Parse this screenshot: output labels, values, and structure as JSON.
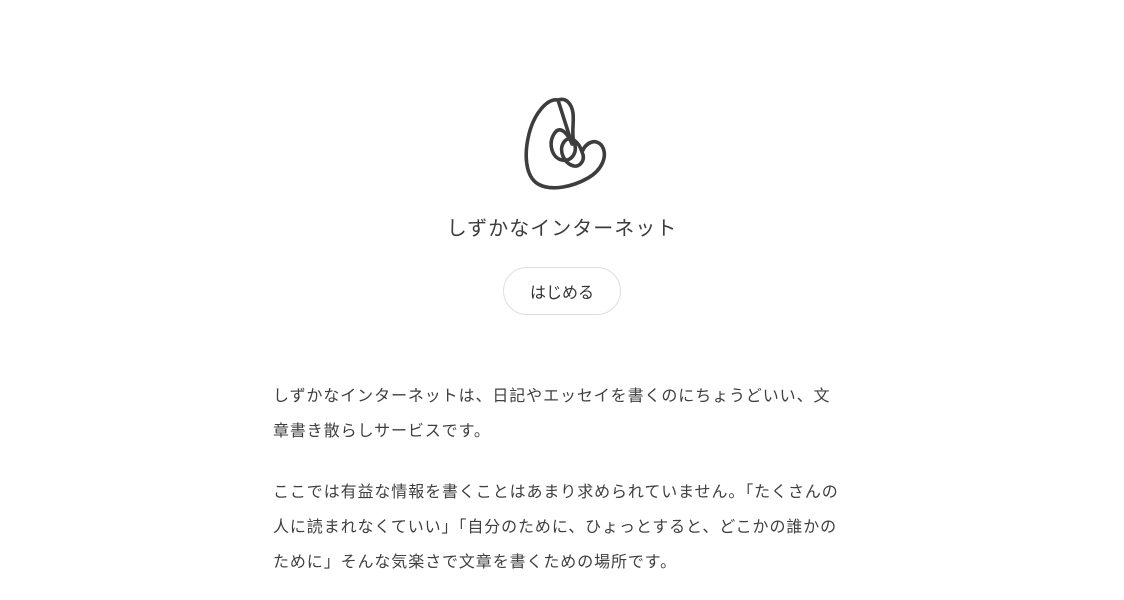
{
  "header": {
    "logo_icon": "scribble-logo-icon",
    "site_title": "しずかなインターネット",
    "start_button_label": "はじめる"
  },
  "intro": {
    "paragraphs": [
      "しずかなインターネットは、日記やエッセイを書くのにちょうどいい、文章書き散らしサービスです。",
      "ここでは有益な情報を書くことはあまり求められていません。「たくさんの人に読まれなくていい」「自分のために、ひょっとすると、どこかの誰かのために」そんな気楽さで文章を書くための場所です。"
    ]
  },
  "colors": {
    "text": "#3a3a3a",
    "logo_stroke": "#3d3d3d",
    "button_border": "#dedede",
    "background": "#ffffff"
  }
}
